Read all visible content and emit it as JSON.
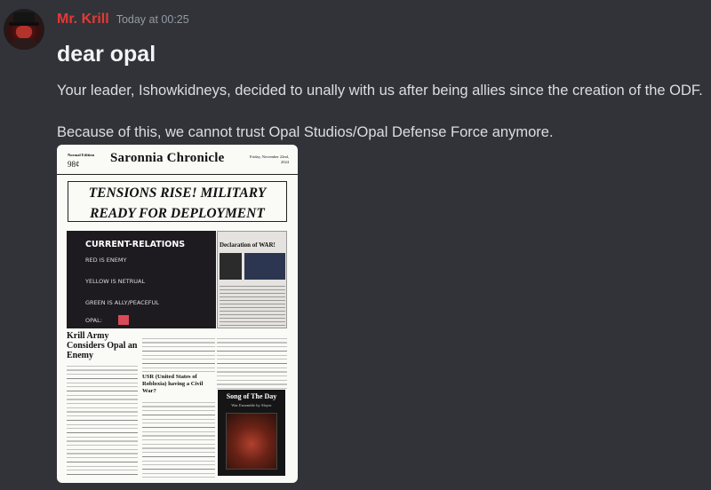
{
  "message": {
    "username": "Mr. Krill",
    "timestamp": "Today at 00:25",
    "heading": "dear opal",
    "line1": "Your leader, Ishowkidneys, decided to unally with us after being allies since the creation of the ODF.",
    "line2": "Because of this, we cannot trust Opal Studios/Opal Defense Force anymore."
  },
  "newspaper": {
    "edition": "Normal Edition",
    "price": "98¢",
    "masthead": "Saronnia Chronicle",
    "dateline": "Friday, November 22nd, 2024",
    "headline_line1": "TENSIONS RISE! MILITARY",
    "headline_line2": "READY FOR DEPLOYMENT",
    "relations": {
      "title": "CURRENT-RELATIONS",
      "items": [
        "RED IS ENEMY",
        "YELLOW IS NETRUAL",
        "GREEN IS ALLY/PEACEFUL",
        "OPAL:"
      ],
      "opal_color": "#d94a5a"
    },
    "declaration_title": "Declaration of WAR!",
    "story1_title": "Krill Army Considers Opal an Enemy",
    "story2_title": "USR (United States of Robloxia) having a Civil War?",
    "song_title": "Song of The Day",
    "song_subtitle": "War Ensemble by Slayer"
  },
  "colors": {
    "background": "#313338",
    "username": "#e53935",
    "timestamp": "#949ba4",
    "text": "#dbdee1"
  }
}
